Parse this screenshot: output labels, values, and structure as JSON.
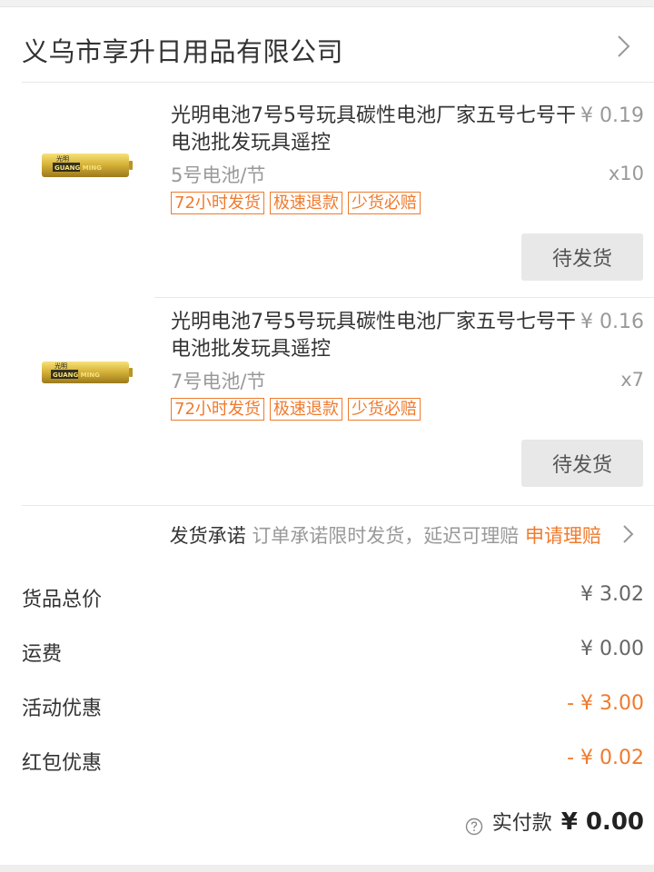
{
  "shop": {
    "name": "义乌市享升日用品有限公司"
  },
  "products": [
    {
      "title": "光明电池7号5号玩具碳性电池厂家五号七号干电池批发玩具遥控",
      "price": "¥ 0.19",
      "spec": "5号电池/节",
      "quantity": "x10",
      "tags": [
        "72小时发货",
        "极速退款",
        "少货必赔"
      ],
      "status": "待发货",
      "image_brand": "GUANG MING",
      "image_brand_cn": "光明"
    },
    {
      "title": "光明电池7号5号玩具碳性电池厂家五号七号干电池批发玩具遥控",
      "price": "¥ 0.16",
      "spec": "7号电池/节",
      "quantity": "x7",
      "tags": [
        "72小时发货",
        "极速退款",
        "少货必赔"
      ],
      "status": "待发货",
      "image_brand": "GUANG MING",
      "image_brand_cn": "光明"
    }
  ],
  "promise": {
    "label": "发货承诺",
    "text": "订单承诺限时发货，延迟可理赔",
    "link": "申请理赔"
  },
  "summary": {
    "goods_total_label": "货品总价",
    "goods_total_value": "¥ 3.02",
    "shipping_label": "运费",
    "shipping_value": "¥ 0.00",
    "activity_discount_label": "活动优惠",
    "activity_discount_value": "- ¥ 3.00",
    "red_packet_label": "红包优惠",
    "red_packet_value": "- ¥ 0.02"
  },
  "payment": {
    "label": "实付款",
    "value": "¥ 0.00"
  },
  "colors": {
    "accent": "#f07a2c",
    "muted_text": "#999999",
    "button_bg": "#e8e8e8"
  }
}
